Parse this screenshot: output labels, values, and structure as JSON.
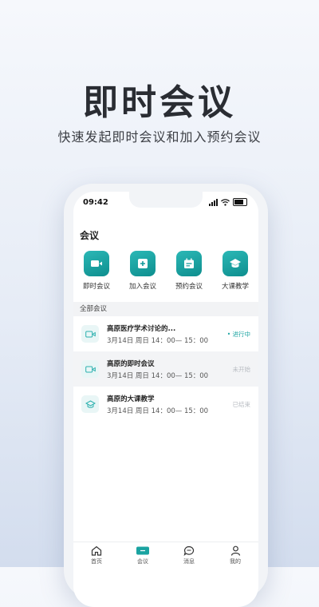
{
  "hero": {
    "title": "即时会议",
    "subtitle": "快速发起即时会议和加入预约会议"
  },
  "status_bar": {
    "time": "09:42"
  },
  "page_title": "会议",
  "actions": [
    {
      "label": "即时会议",
      "icon": "video-camera-icon"
    },
    {
      "label": "加入会议",
      "icon": "plus-box-icon"
    },
    {
      "label": "预约会议",
      "icon": "calendar-icon"
    },
    {
      "label": "大课教学",
      "icon": "graduation-cap-icon"
    }
  ],
  "section_title": "全部会议",
  "meetings": [
    {
      "title": "高原医疗学术讨论的...",
      "time": "3月14日 周日 14：00— 15：00",
      "status": "• 进行中",
      "icon": "video-camera-icon"
    },
    {
      "title": "高原的即时会议",
      "time": "3月14日 周日 14：00— 15：00",
      "status": "未开始",
      "icon": "video-camera-icon"
    },
    {
      "title": "高原的大课教学",
      "time": "3月14日 周日 14：00— 15：00",
      "status": "已结束",
      "icon": "graduation-cap-icon"
    }
  ],
  "tabs": [
    {
      "label": "首页",
      "icon": "home-icon"
    },
    {
      "label": "会议",
      "icon": "video-camera-icon",
      "active": true
    },
    {
      "label": "消息",
      "icon": "chat-bubble-icon"
    },
    {
      "label": "我的",
      "icon": "user-icon"
    }
  ],
  "colors": {
    "accent": "#1aa3a1",
    "accent_dark": "#0e8e8e"
  }
}
